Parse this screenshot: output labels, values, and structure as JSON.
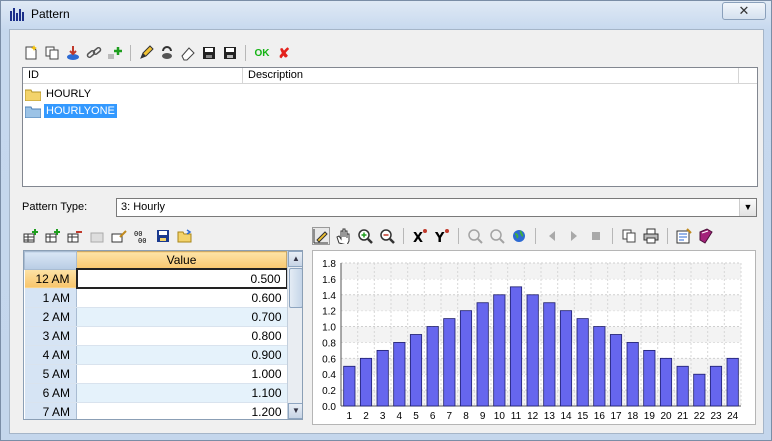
{
  "window": {
    "title": "Pattern",
    "close_label": "✕"
  },
  "top_toolbar": {
    "icons": [
      "new-icon",
      "copy-icon",
      "import-icon",
      "link-icon",
      "add-icon",
      "edit-icon",
      "refresh-icon",
      "eraser-icon",
      "save-icon",
      "save-as-icon"
    ],
    "ok_label": "OK",
    "cancel_label": "✘"
  },
  "list": {
    "columns": [
      "ID",
      "Description"
    ],
    "items": [
      {
        "id": "HOURLY",
        "selected": false
      },
      {
        "id": "HOURLYONE",
        "selected": true
      }
    ]
  },
  "pattern_type": {
    "label": "Pattern Type:",
    "value": "3: Hourly"
  },
  "grid": {
    "column": "Value",
    "rows": [
      {
        "hour": "12 AM",
        "value": "0.500"
      },
      {
        "hour": "1 AM",
        "value": "0.600"
      },
      {
        "hour": "2 AM",
        "value": "0.700"
      },
      {
        "hour": "3 AM",
        "value": "0.800"
      },
      {
        "hour": "4 AM",
        "value": "0.900"
      },
      {
        "hour": "5 AM",
        "value": "1.000"
      },
      {
        "hour": "6 AM",
        "value": "1.100"
      },
      {
        "hour": "7 AM",
        "value": "1.200"
      }
    ]
  },
  "colors": {
    "bar": "#6666ee",
    "bar_stroke": "#1c1c6b",
    "accent": "#3399ff"
  },
  "chart_data": {
    "type": "bar",
    "categories": [
      "1",
      "2",
      "3",
      "4",
      "5",
      "6",
      "7",
      "8",
      "9",
      "10",
      "11",
      "12",
      "13",
      "14",
      "15",
      "16",
      "17",
      "18",
      "19",
      "20",
      "21",
      "22",
      "23",
      "24"
    ],
    "values": [
      0.5,
      0.6,
      0.7,
      0.8,
      0.9,
      1.0,
      1.1,
      1.2,
      1.3,
      1.4,
      1.5,
      1.4,
      1.3,
      1.2,
      1.1,
      1.0,
      0.9,
      0.8,
      0.7,
      0.6,
      0.5,
      0.4,
      0.5,
      0.6
    ],
    "ylim": [
      0,
      1.8
    ],
    "yticks": [
      "0.0",
      "0.2",
      "0.4",
      "0.6",
      "0.8",
      "1.0",
      "1.2",
      "1.4",
      "1.6",
      "1.8"
    ],
    "grid": true,
    "title": "",
    "xlabel": "",
    "ylabel": ""
  }
}
